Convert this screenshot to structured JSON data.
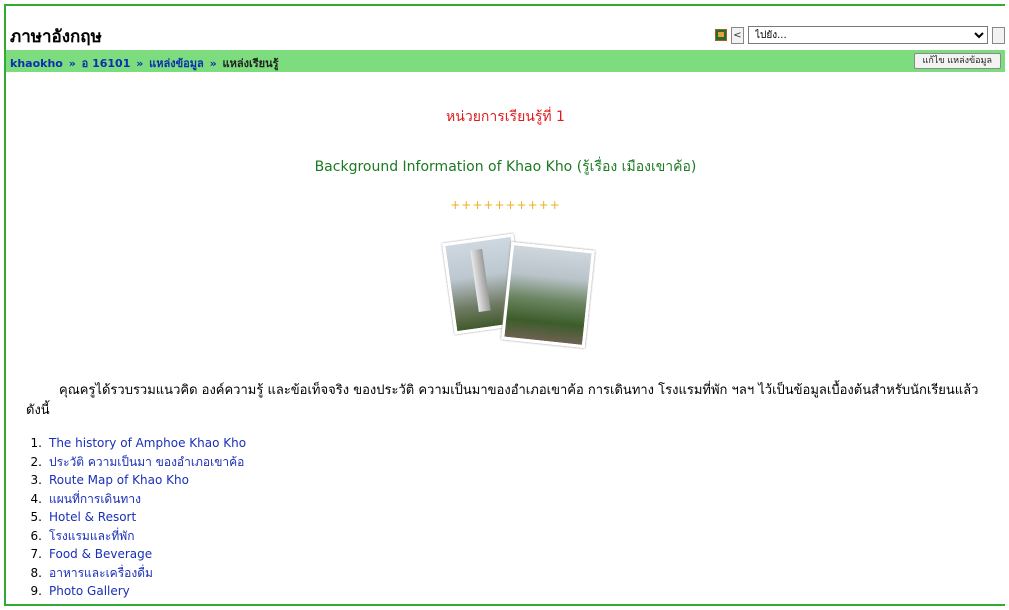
{
  "header": {
    "site_title": "ภาษาอังกฤษ",
    "jump_select_value": "ไปยัง..."
  },
  "navbar": {
    "breadcrumb": [
      {
        "label": "khaokho",
        "link": true
      },
      {
        "label": "อ 16101",
        "link": true
      },
      {
        "label": "แหล่งข้อมูล",
        "link": true
      },
      {
        "label": "แหล่งเรียนรู้",
        "link": false
      }
    ],
    "separator": "»",
    "edit_button": "แก้ไข แหล่งข้อมูล"
  },
  "content": {
    "unit_title": "หน่วยการเรียนรู้ที่ 1",
    "subtitle": "Background Information of Khao Kho (รู้เรื่อง เมืองเขาค้อ)",
    "divider": "++++++++++",
    "intro": "คุณครูได้รวบรวมแนวคิด องค์ความรู้ และข้อเท็จจริง ของประวัติ ความเป็นมาของอำเภอเขาค้อ การเดินทาง โรงแรมที่พัก ฯลฯ ไว้เป็นข้อมูลเบื้องต้นสำหรับนักเรียนแล้ว ดังนี้",
    "links": [
      {
        "num": "1.",
        "label": "The history of Amphoe Khao Kho"
      },
      {
        "num": "2.",
        "label": "ประวัติ ความเป็นมา ของอำเภอเขาค้อ"
      },
      {
        "num": "3.",
        "label": "Route Map of Khao Kho"
      },
      {
        "num": "4.",
        "label": "แผนที่การเดินทาง"
      },
      {
        "num": "5.",
        "label": "Hotel & Resort"
      },
      {
        "num": "6.",
        "label": "โรงแรมและที่พัก"
      },
      {
        "num": "7.",
        "label": "Food & Beverage"
      },
      {
        "num": "8.",
        "label": "อาหารและเครื่องดื่ม"
      },
      {
        "num": "9.",
        "label": "Photo Gallery"
      }
    ]
  },
  "colors": {
    "frame": "#33aa33",
    "navbar": "#7ddc7d",
    "link": "#1a2fb8",
    "unit_title": "#e01b1b",
    "subtitle": "#1b7a22",
    "divider": "#f0b020"
  }
}
